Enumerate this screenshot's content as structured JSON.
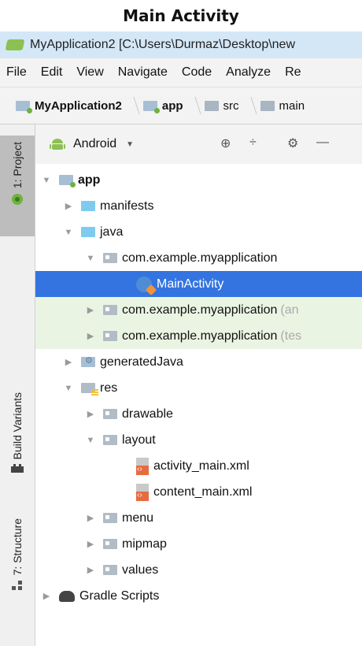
{
  "caption": "Main Activity",
  "window": {
    "title": "MyApplication2 [C:\\Users\\Durmaz\\Desktop\\new"
  },
  "menu": [
    "File",
    "Edit",
    "View",
    "Navigate",
    "Code",
    "Analyze",
    "Re"
  ],
  "breadcrumb": [
    "MyApplication2",
    "app",
    "src",
    "main"
  ],
  "sidebar": {
    "project_tab": "1: Project",
    "build_variants_tab": "Build Variants",
    "structure_tab": "7: Structure"
  },
  "panel": {
    "view_mode": "Android",
    "icons": [
      "crosshair-icon",
      "collapse-icon",
      "gear-icon",
      "hide-icon"
    ]
  },
  "tree": {
    "app": "app",
    "manifests": "manifests",
    "java": "java",
    "pkg_main": "com.example.myapplication",
    "main_activity": "MainActivity",
    "pkg_android_test": "com.example.myapplication",
    "pkg_android_test_suffix": "(an",
    "pkg_test": "com.example.myapplication",
    "pkg_test_suffix": "(tes",
    "generated_java": "generatedJava",
    "res": "res",
    "drawable": "drawable",
    "layout": "layout",
    "activity_main": "activity_main.xml",
    "content_main": "content_main.xml",
    "menu": "menu",
    "mipmap": "mipmap",
    "values": "values",
    "gradle_scripts": "Gradle Scripts"
  },
  "colors": {
    "selection": "#3374e0",
    "highlight_row": "#eaf4e3",
    "title_bar": "#d4e7f7"
  }
}
